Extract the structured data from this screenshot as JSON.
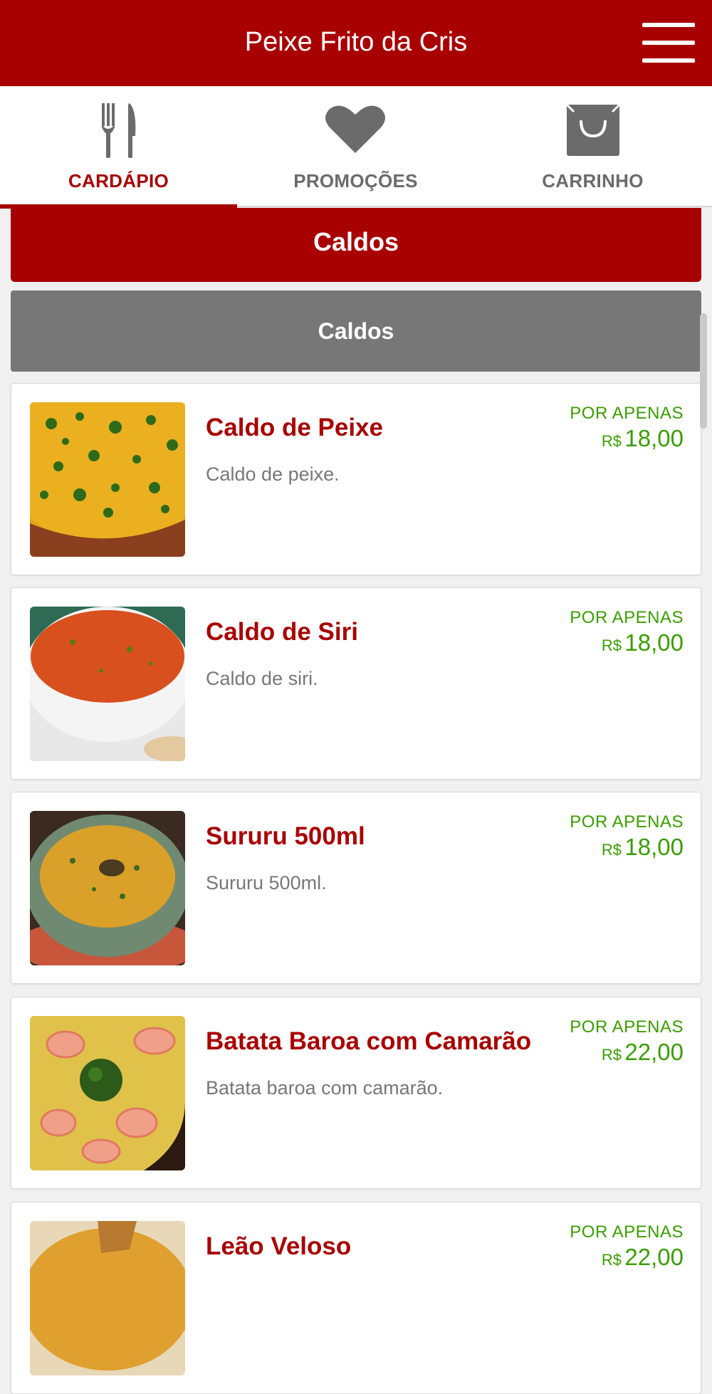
{
  "header": {
    "title": "Peixe Frito da Cris",
    "menu_icon": "hamburger-menu-icon"
  },
  "tabs": [
    {
      "label": "CARDÁPIO",
      "icon": "fork-knife-icon",
      "active": true
    },
    {
      "label": "PROMOÇÕES",
      "icon": "heart-icon",
      "active": false
    },
    {
      "label": "CARRINHO",
      "icon": "shopping-bag-icon",
      "active": false
    }
  ],
  "section": {
    "title": "Caldos"
  },
  "subsection": {
    "title": "Caldos"
  },
  "price_label": "POR APENAS",
  "currency": "R$",
  "items": [
    {
      "name": "Caldo de Peixe",
      "description": "Caldo de peixe.",
      "price": "18,00"
    },
    {
      "name": "Caldo de Siri",
      "description": "Caldo de siri.",
      "price": "18,00"
    },
    {
      "name": "Sururu 500ml",
      "description": "Sururu 500ml.",
      "price": "18,00"
    },
    {
      "name": "Batata Baroa com Camarão",
      "description": "Batata baroa com camarão.",
      "price": "22,00"
    },
    {
      "name": "Leão Veloso",
      "description": "",
      "price": "22,00"
    }
  ],
  "colors": {
    "brand": "#a80000",
    "price": "#3a9d00",
    "subsection": "#777777"
  }
}
